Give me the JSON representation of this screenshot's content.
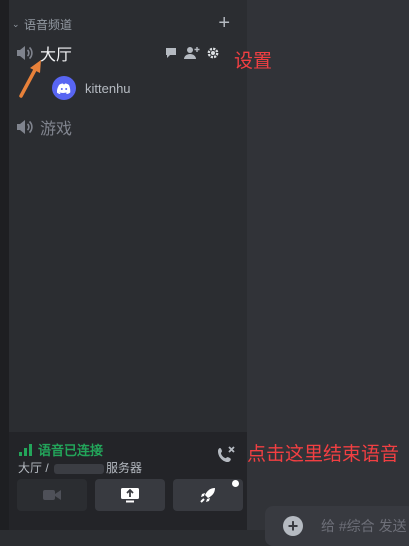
{
  "category": {
    "name": "语音频道",
    "add_icon": "plus-icon"
  },
  "channels": [
    {
      "name": "大厅",
      "icon": "speaker-icon",
      "active": true,
      "actions": [
        "chat-icon",
        "invite-icon",
        "gear-icon"
      ]
    },
    {
      "name": "游戏",
      "icon": "speaker-icon",
      "active": false
    }
  ],
  "members": [
    {
      "name": "kittenhu",
      "avatar": "discord-avatar-icon"
    }
  ],
  "annotations": {
    "settings": "设置",
    "end_voice": "点击这里结束语音"
  },
  "voice": {
    "status": "语音已连接",
    "location_prefix": "大厅 / ",
    "location_suffix": "服务器",
    "buttons": [
      "camera-icon",
      "screen-share-icon",
      "activity-icon"
    ]
  },
  "chat": {
    "placeholder": "给 #综合 发送"
  },
  "colors": {
    "annotation": "#f23f42",
    "connected": "#23a55a",
    "arrow": "#e8813a"
  }
}
